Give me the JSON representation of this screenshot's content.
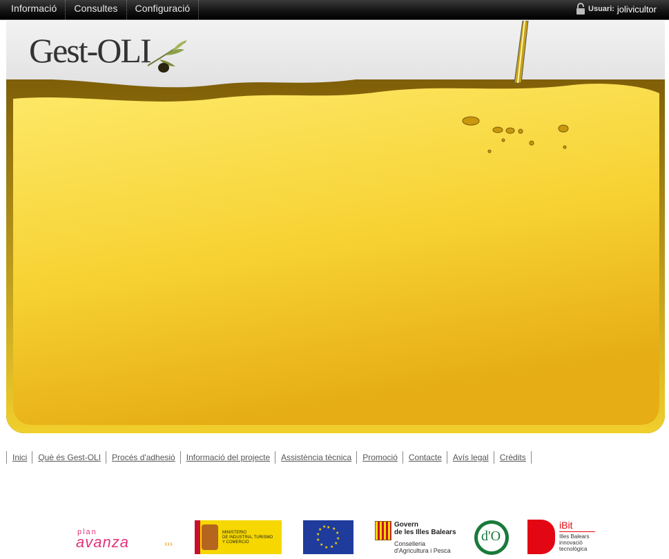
{
  "topnav": {
    "items": [
      {
        "label": "Informació"
      },
      {
        "label": "Consultes"
      },
      {
        "label": "Configuració"
      }
    ],
    "user_label": "Usuari:",
    "user_name": "jolivicultor"
  },
  "banner": {
    "logo_text": "Gest-OLI"
  },
  "footer": {
    "links": [
      "Inici",
      "Què és Gest-OLI",
      "Procés d'adhesió",
      "Informació del projecte",
      "Assistència tècnica",
      "Promoció",
      "Contacte",
      "Avís legal",
      "Crèdits"
    ]
  },
  "sponsors": {
    "plan_avanza_small": "plan",
    "plan_avanza": "avanza",
    "ministerio": [
      "MINISTERIO",
      "DE INDUSTRIA, TURISMO",
      "Y COMERCIO"
    ],
    "govern": [
      "Govern",
      "de les Illes Balears",
      "Conselleria",
      "d'Agricultura i Pesca"
    ],
    "do_mallorca": "d'O",
    "ibit_title": "iBit",
    "ibit_lines": [
      "Illes Balears",
      "innovació",
      "tecnològica"
    ]
  },
  "colors": {
    "oil_light": "#fce85a",
    "oil_dark": "#e9b41b",
    "avanza_pink": "#e2337a",
    "ministerio_yellow": "#f6d800",
    "eu_blue": "#1f3b9b",
    "ibit_red": "#e30613"
  }
}
